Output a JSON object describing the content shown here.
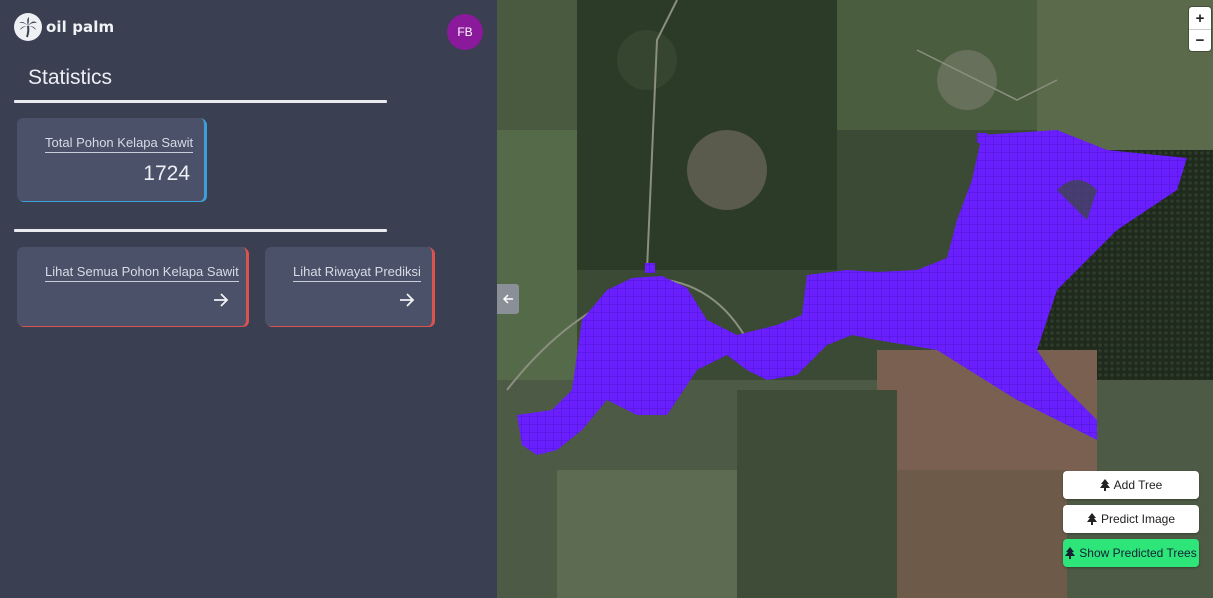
{
  "app": {
    "name": "oil palm",
    "logo_icon": "palm-tree-icon"
  },
  "user": {
    "initials": "FB",
    "avatar_color": "#8a1a9b"
  },
  "page": {
    "title": "Statistics"
  },
  "stats": {
    "total_label": "Total Pohon Kelapa Sawit",
    "total_value": "1724",
    "accent": "#3d9fd8"
  },
  "links": [
    {
      "label": "Lihat Semua Pohon Kelapa Sawit",
      "icon": "arrow-right-icon",
      "accent": "#d9534f"
    },
    {
      "label": "Lihat Riwayat Prediksi",
      "icon": "arrow-right-icon",
      "accent": "#d9534f"
    }
  ],
  "map": {
    "overlay_color": "#6a1fff",
    "zoom_in": "+",
    "zoom_out": "−",
    "collapse_icon": "arrow-left-icon",
    "actions": [
      {
        "label": "Add Tree",
        "icon": "tree-icon"
      },
      {
        "label": "Predict Image",
        "icon": "tree-icon"
      },
      {
        "label": "Show Predicted Trees",
        "icon": "tree-icon",
        "color": "#2ee57a"
      }
    ]
  }
}
